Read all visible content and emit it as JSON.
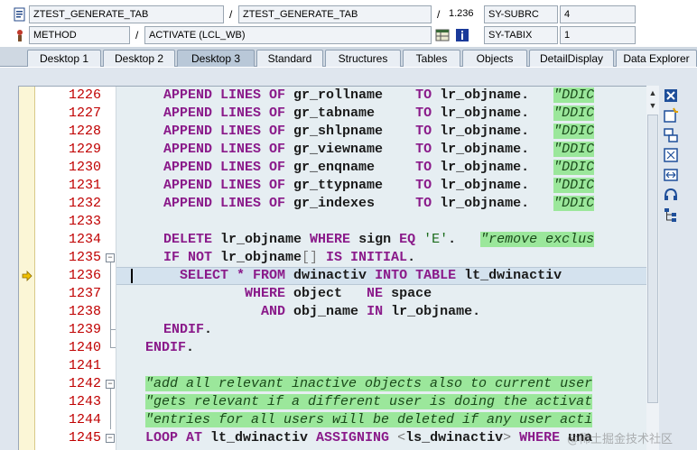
{
  "header": {
    "row1": {
      "program": "ZTEST_GENERATE_TAB",
      "include": "ZTEST_GENERATE_TAB",
      "line_no": "1.236",
      "sysvar_name": "SY-SUBRC",
      "sysvar_value": "4"
    },
    "row2": {
      "kind": "METHOD",
      "event": "ACTIVATE (LCL_WB)",
      "sysvar_name": "SY-TABIX",
      "sysvar_value": "1"
    },
    "separator": "/"
  },
  "tabs": [
    {
      "label": "Desktop 1",
      "active": false
    },
    {
      "label": "Desktop 2",
      "active": false
    },
    {
      "label": "Desktop 3",
      "active": true
    },
    {
      "label": "Standard",
      "active": false
    },
    {
      "label": "Structures",
      "active": false
    },
    {
      "label": "Tables",
      "active": false
    },
    {
      "label": "Objects",
      "active": false
    },
    {
      "label": "DetailDisplay",
      "active": false
    },
    {
      "label": "Data Explorer",
      "active": false
    }
  ],
  "editor": {
    "current_line": "1236",
    "lines": [
      {
        "n": "1226",
        "parts": [
          [
            "kw",
            "APPEND LINES OF "
          ],
          [
            "id",
            "gr_rollname    "
          ],
          [
            "kw",
            "TO "
          ],
          [
            "id",
            "lr_objname.   "
          ],
          [
            "cmt",
            "\"DDIC"
          ]
        ]
      },
      {
        "n": "1227",
        "parts": [
          [
            "kw",
            "APPEND LINES OF "
          ],
          [
            "id",
            "gr_tabname     "
          ],
          [
            "kw",
            "TO "
          ],
          [
            "id",
            "lr_objname.   "
          ],
          [
            "cmt",
            "\"DDIC"
          ]
        ]
      },
      {
        "n": "1228",
        "parts": [
          [
            "kw",
            "APPEND LINES OF "
          ],
          [
            "id",
            "gr_shlpname    "
          ],
          [
            "kw",
            "TO "
          ],
          [
            "id",
            "lr_objname.   "
          ],
          [
            "cmt",
            "\"DDIC"
          ]
        ]
      },
      {
        "n": "1229",
        "parts": [
          [
            "kw",
            "APPEND LINES OF "
          ],
          [
            "id",
            "gr_viewname    "
          ],
          [
            "kw",
            "TO "
          ],
          [
            "id",
            "lr_objname.   "
          ],
          [
            "cmt",
            "\"DDIC"
          ]
        ]
      },
      {
        "n": "1230",
        "parts": [
          [
            "kw",
            "APPEND LINES OF "
          ],
          [
            "id",
            "gr_enqname     "
          ],
          [
            "kw",
            "TO "
          ],
          [
            "id",
            "lr_objname.   "
          ],
          [
            "cmt",
            "\"DDIC"
          ]
        ]
      },
      {
        "n": "1231",
        "parts": [
          [
            "kw",
            "APPEND LINES OF "
          ],
          [
            "id",
            "gr_ttypname    "
          ],
          [
            "kw",
            "TO "
          ],
          [
            "id",
            "lr_objname.   "
          ],
          [
            "cmt",
            "\"DDIC"
          ]
        ]
      },
      {
        "n": "1232",
        "parts": [
          [
            "kw",
            "APPEND LINES OF "
          ],
          [
            "id",
            "gr_indexes     "
          ],
          [
            "kw",
            "TO "
          ],
          [
            "id",
            "lr_objname.   "
          ],
          [
            "cmt",
            "\"DDIC"
          ]
        ]
      },
      {
        "n": "1233",
        "parts": []
      },
      {
        "n": "1234",
        "parts": [
          [
            "kw",
            "DELETE "
          ],
          [
            "id",
            "lr_objname "
          ],
          [
            "kw",
            "WHERE "
          ],
          [
            "id",
            "sign "
          ],
          [
            "kw",
            "EQ "
          ],
          [
            "str",
            "'E'"
          ],
          [
            "id",
            ".   "
          ],
          [
            "cmt",
            "\"remove exclus"
          ]
        ]
      },
      {
        "n": "1235",
        "parts": [
          [
            "kw",
            "IF NOT "
          ],
          [
            "id",
            "lr_objname"
          ],
          [
            "dim",
            "[]"
          ],
          [
            "kw",
            " IS INITIAL"
          ],
          [
            "id",
            "."
          ]
        ]
      },
      {
        "n": "1236",
        "parts": [
          [
            "id",
            "  "
          ],
          [
            "kw",
            "SELECT * FROM "
          ],
          [
            "id",
            "dwinactiv "
          ],
          [
            "kw",
            "INTO TABLE "
          ],
          [
            "id",
            "lt_dwinactiv"
          ]
        ]
      },
      {
        "n": "1237",
        "parts": [
          [
            "id",
            "          "
          ],
          [
            "kw",
            "WHERE "
          ],
          [
            "id",
            "object   "
          ],
          [
            "kw",
            "NE "
          ],
          [
            "id",
            "space"
          ]
        ]
      },
      {
        "n": "1238",
        "parts": [
          [
            "id",
            "            "
          ],
          [
            "kw",
            "AND "
          ],
          [
            "id",
            "obj_name "
          ],
          [
            "kw",
            "IN "
          ],
          [
            "id",
            "lr_objname."
          ]
        ]
      },
      {
        "n": "1239",
        "parts": [
          [
            "kw",
            "ENDIF"
          ],
          [
            "id",
            "."
          ]
        ]
      },
      {
        "n": "1240",
        "parts": [
          [
            "kw",
            "ENDIF"
          ],
          [
            "id",
            "."
          ]
        ]
      },
      {
        "n": "1241",
        "parts": []
      },
      {
        "n": "1242",
        "parts": [
          [
            "cmt",
            "\"add all relevant inactive objects also to current user"
          ]
        ]
      },
      {
        "n": "1243",
        "parts": [
          [
            "cmt",
            "\"gets relevant if a different user is doing the activat"
          ]
        ]
      },
      {
        "n": "1244",
        "parts": [
          [
            "cmt",
            "\"entries for all users will be deleted if any user acti"
          ]
        ]
      },
      {
        "n": "1245",
        "parts": [
          [
            "kw",
            "LOOP AT "
          ],
          [
            "id",
            "lt_dwinactiv "
          ],
          [
            "kw",
            "ASSIGNING "
          ],
          [
            "dim",
            "<"
          ],
          [
            "id",
            "ls_dwinactiv"
          ],
          [
            "dim",
            "> "
          ],
          [
            "kw",
            "WHERE "
          ],
          [
            "id",
            "una"
          ]
        ]
      }
    ]
  },
  "watermark": "@稀土掘金技术社区",
  "colors": {
    "keyword": "#8a1a8a",
    "line_number": "#c00000",
    "comment_bg": "#9be79b",
    "current_line_bg": "#d4e2ee"
  }
}
